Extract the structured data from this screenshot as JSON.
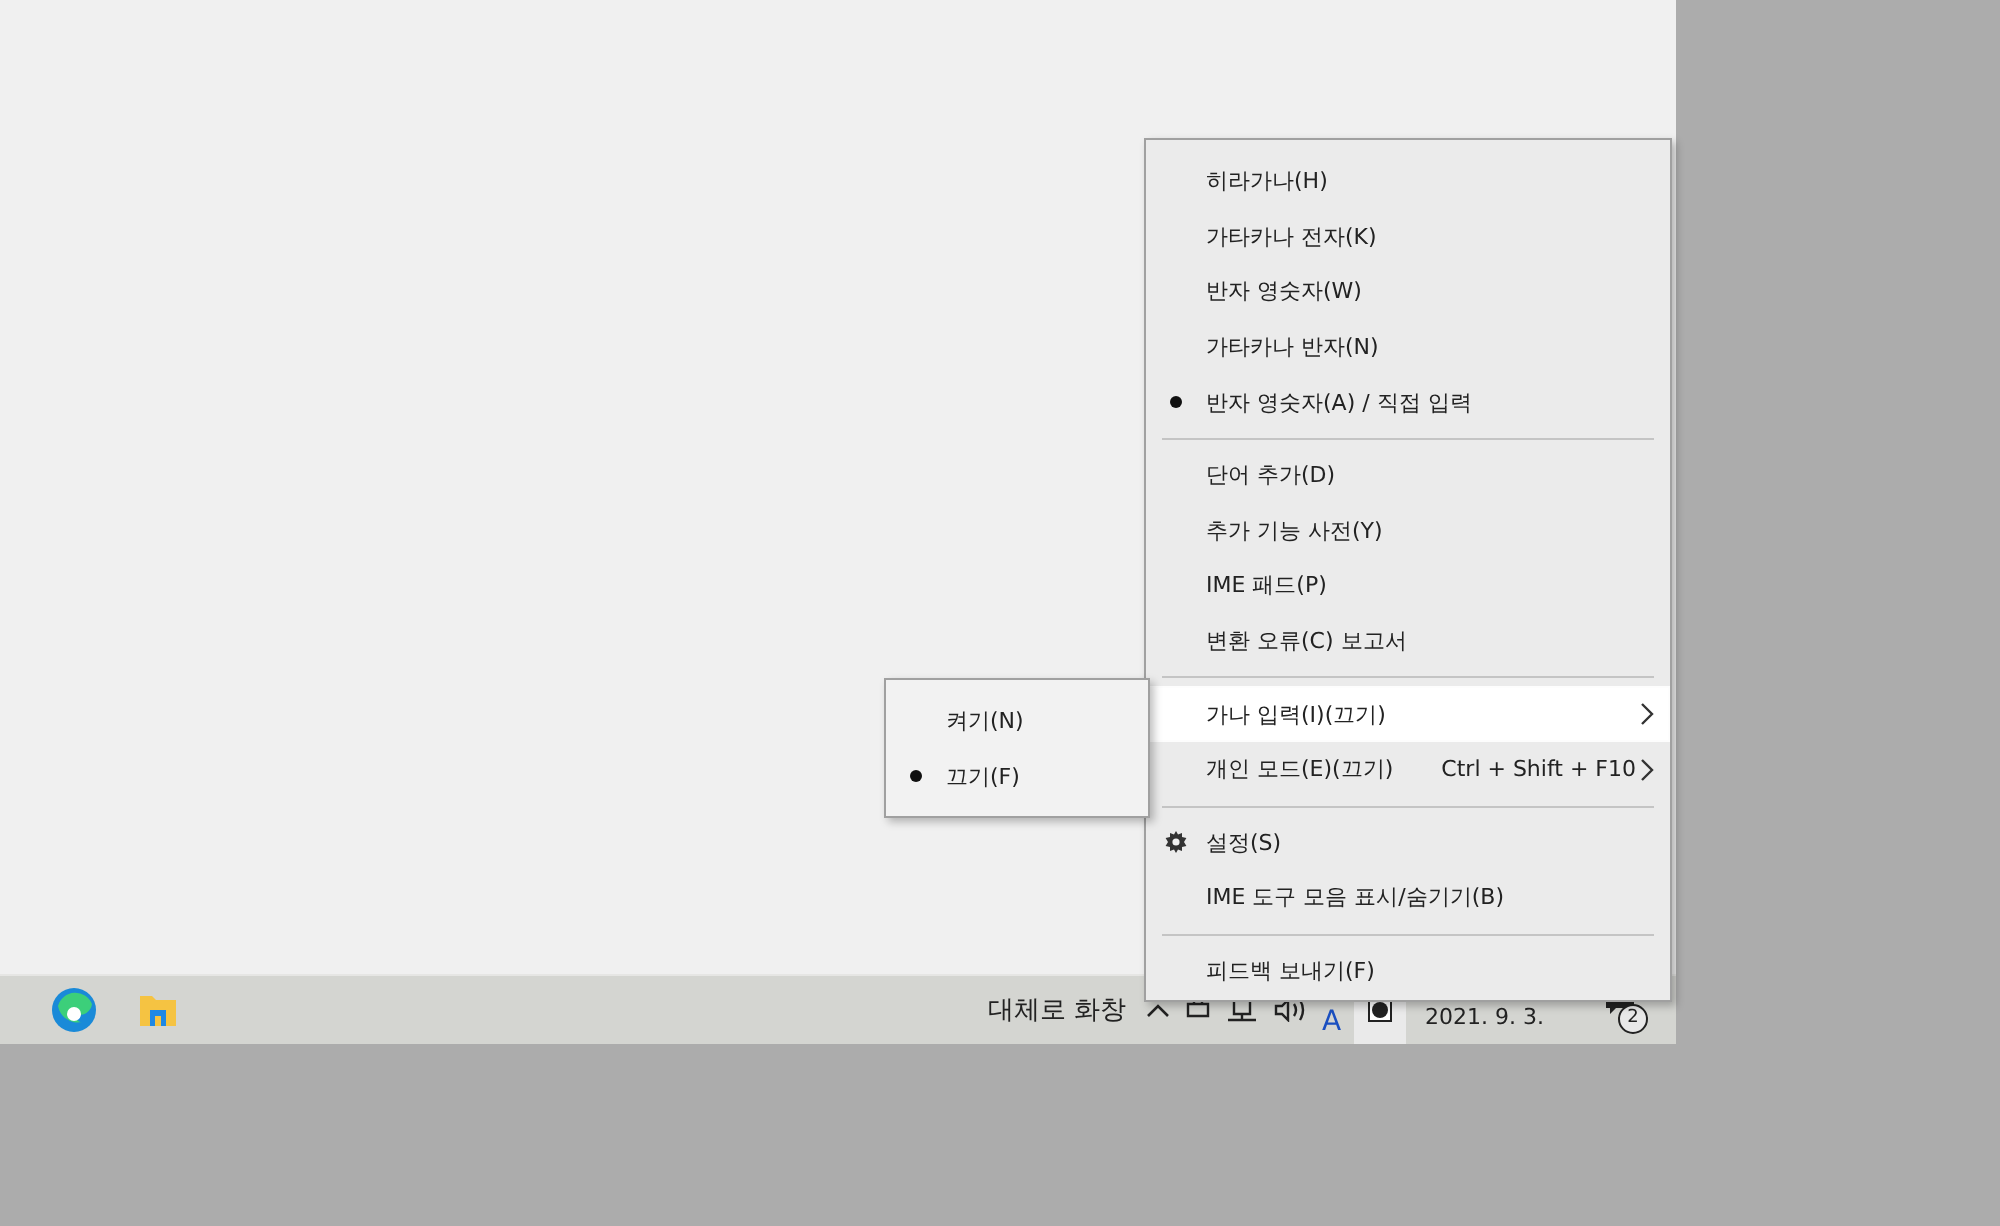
{
  "menu": {
    "items": [
      {
        "kind": "item",
        "label": "히라가나(H)",
        "checked": false,
        "selected": false
      },
      {
        "kind": "item",
        "label": "가타카나 전자(K)",
        "checked": false,
        "selected": false
      },
      {
        "kind": "item",
        "label": "반자 영숫자(W)",
        "checked": false,
        "selected": false
      },
      {
        "kind": "item",
        "label": "가타카나 반자(N)",
        "checked": false,
        "selected": false
      },
      {
        "kind": "item",
        "label": "반자 영숫자(A) / 직접 입력",
        "checked": true,
        "selected": false
      },
      {
        "kind": "separator"
      },
      {
        "kind": "item",
        "label": "단어 추가(D)",
        "checked": false,
        "selected": false
      },
      {
        "kind": "item",
        "label": "추가 기능 사전(Y)",
        "checked": false,
        "selected": false
      },
      {
        "kind": "item",
        "label": "IME 패드(P)",
        "checked": false,
        "selected": false
      },
      {
        "kind": "item",
        "label": "변환 오류(C) 보고서",
        "checked": false,
        "selected": false
      },
      {
        "kind": "separator"
      },
      {
        "kind": "submenu",
        "label": "가나 입력(I)(끄기)",
        "checked": false,
        "selected": true
      },
      {
        "kind": "submenu",
        "label": "개인 모드(E)(끄기)",
        "shortcut": "Ctrl + Shift + F10",
        "checked": false,
        "selected": false
      },
      {
        "kind": "separator"
      },
      {
        "kind": "settings",
        "label": "설정(S)",
        "checked": false,
        "selected": false
      },
      {
        "kind": "item",
        "label": "IME 도구 모음 표시/숨기기(B)",
        "checked": false,
        "selected": false
      },
      {
        "kind": "separator"
      },
      {
        "kind": "item",
        "label": "피드백 보내기(F)",
        "checked": false,
        "selected": false
      }
    ]
  },
  "submenu": {
    "items": [
      {
        "label": "켜기(N)",
        "checked": false
      },
      {
        "label": "끄기(F)",
        "checked": true
      }
    ]
  },
  "taskbar": {
    "weather": "대체로 화창",
    "ime_mode": "A",
    "date": "2021. 9. 3.",
    "notification_count": "2"
  }
}
